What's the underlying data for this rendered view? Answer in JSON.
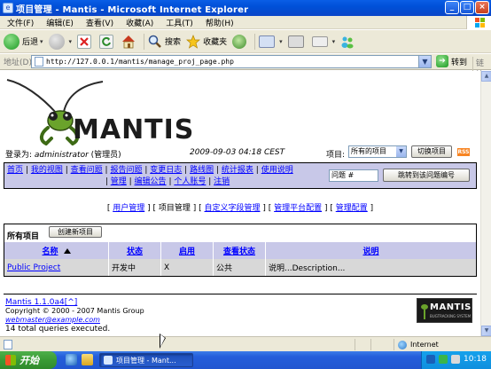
{
  "window": {
    "title": "项目管理 - Mantis - Microsoft Internet Explorer",
    "controls": [
      "_",
      "□",
      "×"
    ]
  },
  "menubar": {
    "items": [
      "文件(F)",
      "编辑(E)",
      "查看(V)",
      "收藏(A)",
      "工具(T)",
      "帮助(H)"
    ]
  },
  "toolbar": {
    "back_label": "后退",
    "search_label": "搜索",
    "favorites_label": "收藏夹"
  },
  "addressbar": {
    "label": "地址(D)",
    "url": "http://127.0.0.1/mantis/manage_proj_page.php",
    "go_label": "转到",
    "links_label": "链接"
  },
  "mantis": {
    "logo_text": "MANTIS",
    "login_label": "登录为: ",
    "login_user": "administrator",
    "login_role": " (管理员)",
    "datetime": "2009-09-03 04:18 CEST",
    "project_label": "项目:",
    "project_selected": "所有的项目",
    "switch_button": "切换项目",
    "rss_label": "RSS",
    "nav": {
      "row1": [
        "首页",
        "我的视图",
        "查看问题",
        "报告问题",
        "变更日志",
        "路线图",
        "统计报表",
        "使用说明"
      ],
      "row2": [
        "管理",
        "编辑公告",
        "个人账号",
        "注销"
      ],
      "issue_placeholder": "问题 #",
      "jump_button": "跳转到该问题编号"
    },
    "manage_tabs": {
      "users": "用户管理",
      "projects": "项目管理",
      "custom_fields": "自定义字段管理",
      "platforms": "管理平台配置",
      "config": "管理配置"
    },
    "projects": {
      "title": "所有项目",
      "create_button": "创建新项目",
      "columns": [
        "名称",
        "状态",
        "启用",
        "查看状态",
        "说明"
      ],
      "rows": [
        {
          "name": "Public Project",
          "status": "开发中",
          "enabled": "X",
          "view_state": "公共",
          "description": "说明...Description..."
        }
      ]
    },
    "footer": {
      "version": "Mantis 1.1.0a4",
      "version_link": "[^]",
      "copyright": "Copyright © 2000 - 2007 Mantis Group",
      "email": "webmaster@example.com",
      "queries": "14 total queries executed.",
      "logo_text": "MANTIS",
      "logo_sub": "BUGTRACKING SYSTEM"
    }
  },
  "statusbar": {
    "zone": "Internet"
  },
  "taskbar": {
    "start_label": "开始",
    "task_label": "项目管理 - Mant...",
    "clock": "10:18"
  },
  "colors": {
    "nav_bg": "#c8c8e8",
    "table_header_bg": "#c8c8e8",
    "row_bg": "#d8d8d8",
    "link": "#0000ff",
    "title_bar": "#0a5ee6",
    "taskbar": "#245edb",
    "start_button": "#3a9b35"
  }
}
